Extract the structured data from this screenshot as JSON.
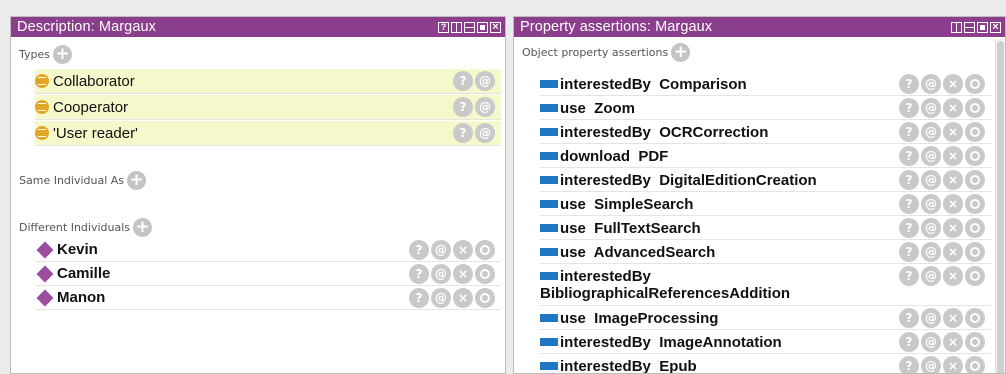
{
  "description_panel": {
    "title": "Description: Margaux",
    "types_label": "Types",
    "types": [
      "Collaborator",
      "Cooperator",
      "'User reader'"
    ],
    "same_individual_label": "Same Individual As",
    "different_individuals_label": "Different Individuals",
    "different_individuals": [
      "Kevin",
      "Camille",
      "Manon"
    ]
  },
  "property_panel": {
    "title": "Property assertions: Margaux",
    "object_property_label": "Object property assertions",
    "assertions": [
      {
        "text": "interestedBy  Comparison"
      },
      {
        "text": "use  Zoom"
      },
      {
        "text": "interestedBy  OCRCorrection"
      },
      {
        "text": "download  PDF"
      },
      {
        "text": "interestedBy  DigitalEditionCreation"
      },
      {
        "text": "use  SimpleSearch"
      },
      {
        "text": "use  FullTextSearch"
      },
      {
        "text": "use  AdvancedSearch"
      },
      {
        "text": "interestedBy",
        "text2": "BibliographicalReferencesAddition"
      },
      {
        "text": "use  ImageProcessing"
      },
      {
        "text": "interestedBy  ImageAnnotation"
      },
      {
        "text": "interestedBy  Epub"
      }
    ]
  },
  "button_glyphs": {
    "help": "?",
    "annotate": "@",
    "delete": "×",
    "add": "+"
  },
  "colors": {
    "header": "#8b3e8c",
    "type_row": "#f7f7cc",
    "property_icon": "#1f78c6",
    "individual_icon": "#9c4d9c",
    "class_icon": "#e2a722"
  }
}
